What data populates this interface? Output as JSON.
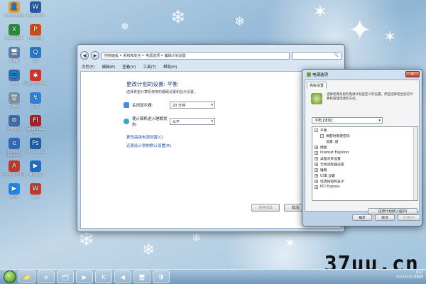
{
  "desktop_icons": [
    {
      "label": "Administrator",
      "color": "#d6a34a",
      "glyph": "👤"
    },
    {
      "label": "Excel 2010",
      "color": "#2b8a3e",
      "glyph": "X"
    },
    {
      "label": "计算机",
      "color": "#5a7fb0",
      "glyph": "🖥"
    },
    {
      "label": "网络",
      "color": "#3f73b2",
      "glyph": "🌐"
    },
    {
      "label": "回收站",
      "color": "#7a93ab",
      "glyph": "🗑"
    },
    {
      "label": "控制面板",
      "color": "#3c6ea8",
      "glyph": "⚙"
    },
    {
      "label": "Internet Explorer",
      "color": "#2f6bbd",
      "glyph": "e"
    },
    {
      "label": "AutoCAD 2010",
      "color": "#c0392b",
      "glyph": "A"
    },
    {
      "label": "PPTV",
      "color": "#1e88e5",
      "glyph": "▶"
    },
    {
      "label": "Word 2010",
      "color": "#2559a8",
      "glyph": "W"
    },
    {
      "label": "PPT 2010",
      "color": "#c94c1b",
      "glyph": "P"
    },
    {
      "label": "QQ",
      "color": "#2a77c9",
      "glyph": "Q"
    },
    {
      "label": "Google Chrome",
      "color": "#d93025",
      "glyph": "◉"
    },
    {
      "label": "迅雷",
      "color": "#2f7fd8",
      "glyph": "↯"
    },
    {
      "label": "Adobe Flash Pro",
      "color": "#a8222c",
      "glyph": "Fl"
    },
    {
      "label": "Photoshop",
      "color": "#1b5ea8",
      "glyph": "Ps"
    },
    {
      "label": "暴风影音",
      "color": "#1d6fc1",
      "glyph": "▶"
    },
    {
      "label": "WPS",
      "color": "#c23a2f",
      "glyph": "W"
    }
  ],
  "control_panel": {
    "nav_back": "◀",
    "nav_forward": "▶",
    "breadcrumb": [
      "控制面板",
      "系统和安全",
      "电源选项",
      "编辑计划设置"
    ],
    "search_placeholder": "🔍",
    "menu": [
      "文件(F)",
      "编辑(E)",
      "查看(V)",
      "工具(T)",
      "帮助(H)"
    ],
    "heading": "更改计划的设置: 平衡",
    "subheading": "选择希望计算机使用的睡眠设置和显示设置。",
    "settings": [
      {
        "label": "关闭显示器:",
        "value": "20 分钟",
        "icon_color": "#4a8bd6"
      },
      {
        "label": "使计算机进入睡眠状态:",
        "value": "从不",
        "icon_color": "#3aa3d4"
      }
    ],
    "link_advanced": "更改高级电源设置(C)",
    "link_restore": "还原此计划的默认设置(R)",
    "save_button": "保存修改",
    "cancel_button": "取消"
  },
  "power_options": {
    "title": "电源选项",
    "tab": "高级设置",
    "description": "选择您要为您的电源计划自定义的设置，然后选择适合您的计算机管理电源的方式。",
    "plan": "平衡 [活动]",
    "tree": [
      {
        "text": "平衡",
        "mark": "−",
        "indent": 0
      },
      {
        "text": "唤醒时需要密码",
        "mark": "−",
        "indent": 1
      },
      {
        "text": "设置: 是",
        "mark": "",
        "indent": 2
      },
      {
        "text": "硬盘",
        "mark": "+",
        "indent": 0
      },
      {
        "text": "Internet Explorer",
        "mark": "+",
        "indent": 0
      },
      {
        "text": "桌面背景设置",
        "mark": "+",
        "indent": 0
      },
      {
        "text": "无线适配器设置",
        "mark": "+",
        "indent": 0
      },
      {
        "text": "睡眠",
        "mark": "+",
        "indent": 0
      },
      {
        "text": "USB 设置",
        "mark": "+",
        "indent": 0
      },
      {
        "text": "电源按钮和盖子",
        "mark": "+",
        "indent": 0
      },
      {
        "text": "PCI Express",
        "mark": "+",
        "indent": 0
      }
    ],
    "restore_button": "还原计划默认值(R)",
    "ok_button": "确定",
    "cancel_button": "取消",
    "apply_button": "应用(A)"
  },
  "taskbar": {
    "items": [
      "📁",
      "e",
      "🗂",
      "▶",
      "K",
      "◀",
      "🖥",
      "🛡"
    ],
    "time": "9:37",
    "date": "2014/6/26 星期四"
  },
  "watermark": "37uu.cn"
}
